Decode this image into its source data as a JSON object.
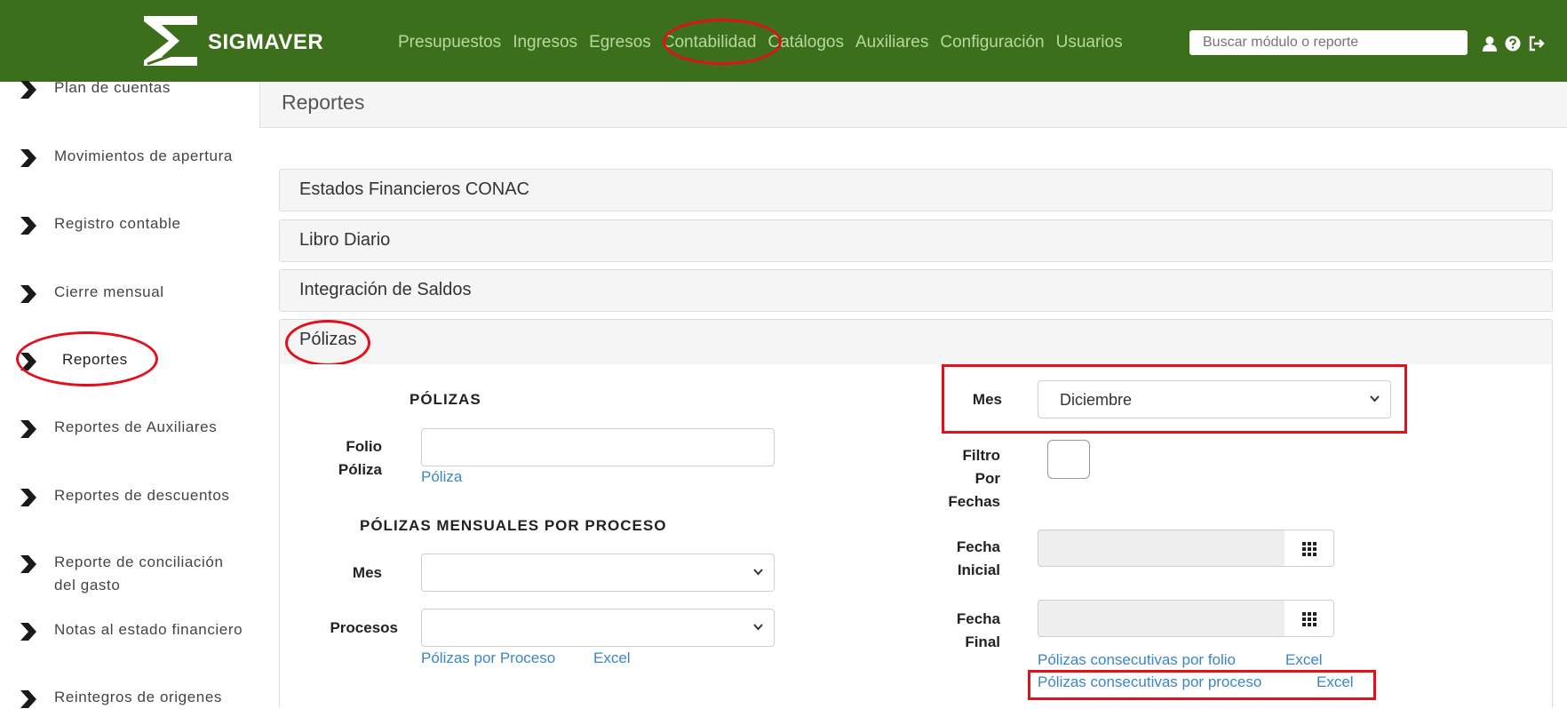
{
  "header": {
    "brand": "SIGMAVER",
    "nav": [
      "Presupuestos",
      "Ingresos",
      "Egresos",
      "Contabilidad",
      "Catálogos",
      "Auxiliares",
      "Configuración",
      "Usuarios"
    ],
    "search_placeholder": "Buscar módulo o reporte",
    "icons": [
      "user-icon",
      "help-icon",
      "logout-icon"
    ],
    "color": "#3c6f1c"
  },
  "sidebar": {
    "items": [
      {
        "label": "Plan de cuentas"
      },
      {
        "label": "Movimientos de apertura"
      },
      {
        "label": "Registro contable"
      },
      {
        "label": "Cierre mensual"
      },
      {
        "label": "Reportes"
      },
      {
        "label": "Reportes de Auxiliares"
      },
      {
        "label": "Reportes de descuentos"
      },
      {
        "label": "Reporte de conciliación del gasto"
      },
      {
        "label": "Notas al estado financiero"
      },
      {
        "label": "Reintegros de origenes"
      }
    ]
  },
  "page": {
    "title": "Reportes"
  },
  "panels": [
    {
      "label": "Estados Financieros CONAC"
    },
    {
      "label": "Libro Diario"
    },
    {
      "label": "Integración de Saldos"
    },
    {
      "label": "Pólizas"
    }
  ],
  "polizas": {
    "section_title": "PÓLIZAS",
    "folio_label_1": "Folio",
    "folio_label_2": "Póliza",
    "folio_value": "",
    "poliza_link": "Póliza",
    "mensuales_title": "PÓLIZAS MENSUALES POR PROCESO",
    "mes_label": "Mes",
    "mes_value": "",
    "procesos_label": "Procesos",
    "procesos_value": "",
    "por_proceso_link": "Pólizas por Proceso",
    "excel_link": "Excel"
  },
  "right": {
    "mes_label": "Mes",
    "mes_value": "Diciembre",
    "filtro_1": "Filtro",
    "filtro_2": "Por",
    "filtro_3": "Fechas",
    "filtro_checked": false,
    "fecha_inicial_1": "Fecha",
    "fecha_inicial_2": "Inicial",
    "fecha_final_1": "Fecha",
    "fecha_final_2": "Final",
    "consec_folio_link": "Pólizas consecutivas por folio",
    "consec_proceso_link": "Pólizas consecutivas por proceso",
    "excel_link": "Excel"
  },
  "annotations": {
    "highlight_color": "#e1101a"
  }
}
